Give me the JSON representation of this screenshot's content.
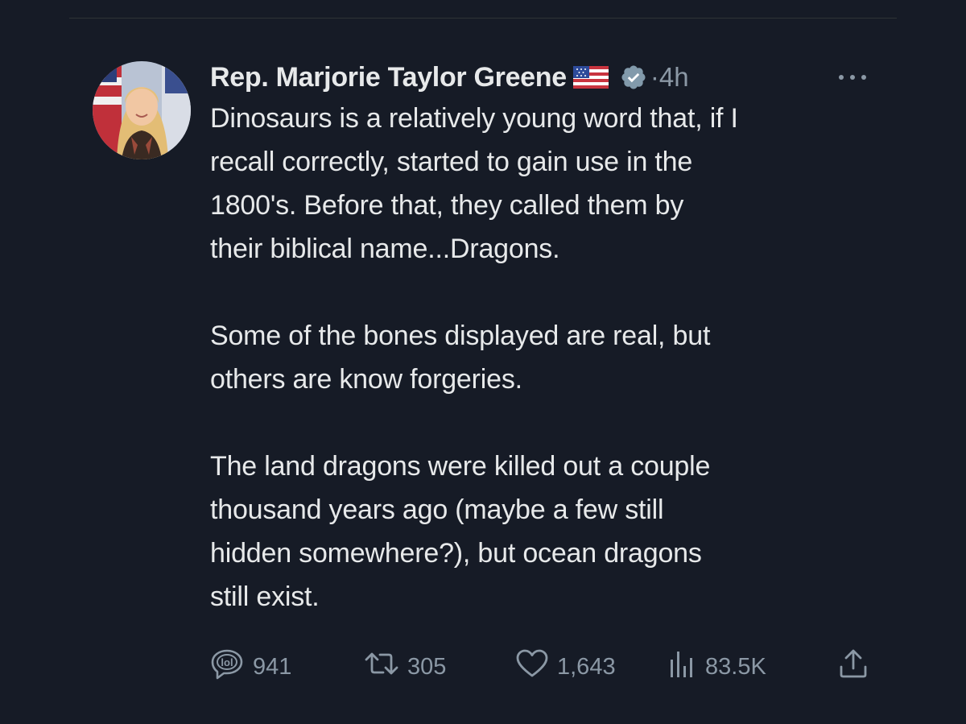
{
  "author": {
    "name": "Rep. Marjorie Taylor Greene",
    "flag_icon": "us-flag-emoji",
    "verified_icon": "verified-badge-icon",
    "separator": "·",
    "time": "4h"
  },
  "tweet": {
    "paragraphs": [
      "Dinosaurs is a relatively young word that, if I\nrecall correctly, started to gain use in the\n1800's. Before that, they called them by\ntheir biblical name...Dragons.",
      "Some of the bones displayed are real, but\nothers are know forgeries.",
      "The land dragons were killed out a couple\nthousand years ago (maybe a few still\nhidden somewhere?), but ocean dragons\nstill exist."
    ]
  },
  "actions": {
    "replies": "941",
    "retweets": "305",
    "likes": "1,643",
    "views": "83.5K"
  },
  "colors": {
    "background": "#161b26",
    "text": "#e7e9ea",
    "muted": "#8b98a5"
  }
}
